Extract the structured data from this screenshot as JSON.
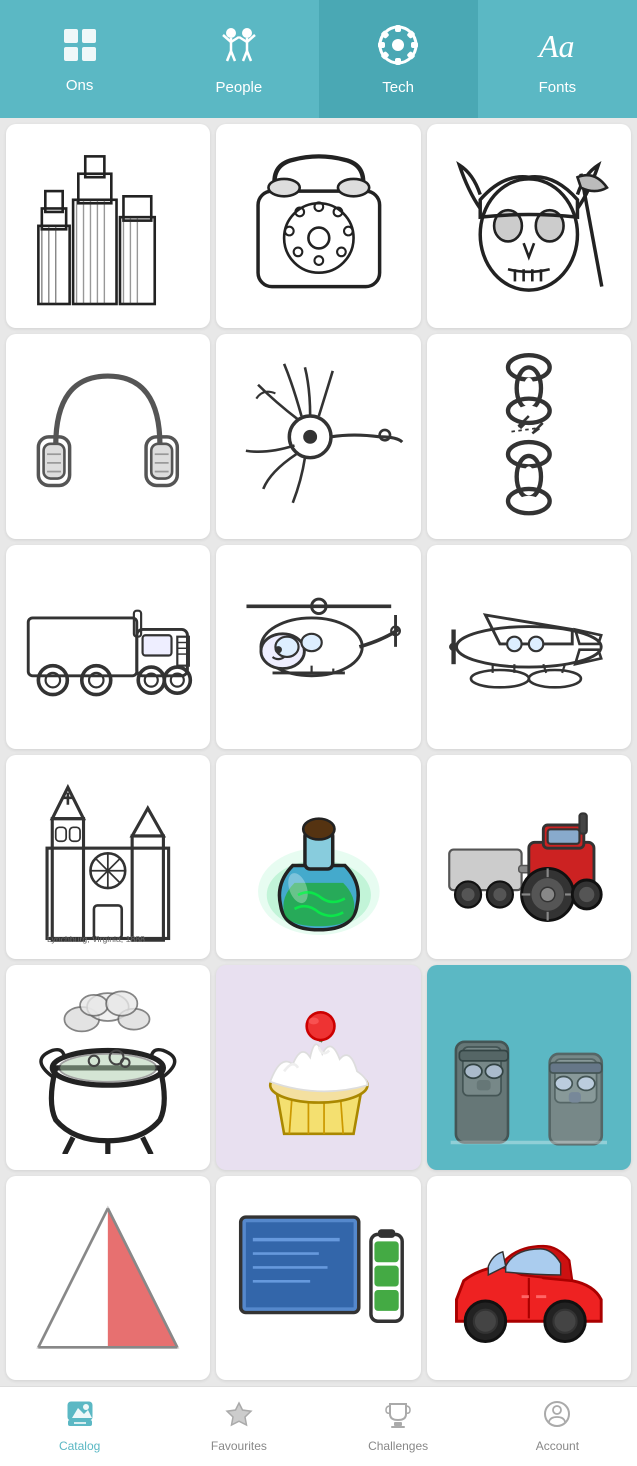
{
  "nav": {
    "tabs": [
      {
        "id": "icons",
        "label": "Ons",
        "icon": "◈",
        "active": false
      },
      {
        "id": "people",
        "label": "People",
        "icon": "👥",
        "active": false
      },
      {
        "id": "tech",
        "label": "Tech",
        "icon": "⚙️",
        "active": true
      },
      {
        "id": "fonts",
        "label": "Fonts",
        "icon": "Aa",
        "active": false
      }
    ]
  },
  "grid": {
    "items": [
      {
        "id": 1,
        "label": "City Skyline",
        "type": "sketch-city"
      },
      {
        "id": 2,
        "label": "Rotary Phone",
        "type": "sketch-phone"
      },
      {
        "id": 3,
        "label": "Viking Helmet",
        "type": "sketch-viking"
      },
      {
        "id": 4,
        "label": "Headphones",
        "type": "sketch-headphones"
      },
      {
        "id": 5,
        "label": "Neuron",
        "type": "sketch-neuron"
      },
      {
        "id": 6,
        "label": "Chain",
        "type": "sketch-chain"
      },
      {
        "id": 7,
        "label": "Truck",
        "type": "sketch-truck"
      },
      {
        "id": 8,
        "label": "Helicopter",
        "type": "sketch-helicopter"
      },
      {
        "id": 9,
        "label": "Seaplane",
        "type": "sketch-seaplane"
      },
      {
        "id": 10,
        "label": "Church",
        "type": "sketch-church"
      },
      {
        "id": 11,
        "label": "Potion",
        "type": "color-potion"
      },
      {
        "id": 12,
        "label": "Tractor",
        "type": "color-tractor"
      },
      {
        "id": 13,
        "label": "Cauldron",
        "type": "sketch-cauldron"
      },
      {
        "id": 14,
        "label": "Cupcake",
        "type": "color-cupcake"
      },
      {
        "id": 15,
        "label": "Easter Island Statues",
        "type": "color-moai"
      },
      {
        "id": 16,
        "label": "Pyramid",
        "type": "sketch-pyramid"
      },
      {
        "id": 17,
        "label": "Computer",
        "type": "color-computer"
      },
      {
        "id": 18,
        "label": "Car",
        "type": "color-car"
      }
    ]
  },
  "bottomNav": {
    "items": [
      {
        "id": "catalog",
        "label": "Catalog",
        "icon": "🖼",
        "active": true
      },
      {
        "id": "favourites",
        "label": "Favourites",
        "icon": "★",
        "active": false
      },
      {
        "id": "challenges",
        "label": "Challenges",
        "icon": "🏆",
        "active": false
      },
      {
        "id": "account",
        "label": "Account",
        "icon": "⚙",
        "active": false
      }
    ]
  }
}
